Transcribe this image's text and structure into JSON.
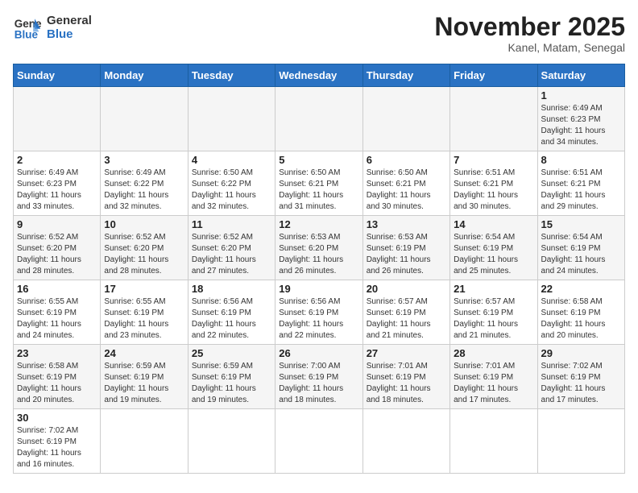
{
  "header": {
    "logo_general": "General",
    "logo_blue": "Blue",
    "month_title": "November 2025",
    "location": "Kanel, Matam, Senegal"
  },
  "weekdays": [
    "Sunday",
    "Monday",
    "Tuesday",
    "Wednesday",
    "Thursday",
    "Friday",
    "Saturday"
  ],
  "weeks": [
    [
      {
        "day": "",
        "info": ""
      },
      {
        "day": "",
        "info": ""
      },
      {
        "day": "",
        "info": ""
      },
      {
        "day": "",
        "info": ""
      },
      {
        "day": "",
        "info": ""
      },
      {
        "day": "",
        "info": ""
      },
      {
        "day": "1",
        "info": "Sunrise: 6:49 AM\nSunset: 6:23 PM\nDaylight: 11 hours\nand 34 minutes."
      }
    ],
    [
      {
        "day": "2",
        "info": "Sunrise: 6:49 AM\nSunset: 6:23 PM\nDaylight: 11 hours\nand 33 minutes."
      },
      {
        "day": "3",
        "info": "Sunrise: 6:49 AM\nSunset: 6:22 PM\nDaylight: 11 hours\nand 32 minutes."
      },
      {
        "day": "4",
        "info": "Sunrise: 6:50 AM\nSunset: 6:22 PM\nDaylight: 11 hours\nand 32 minutes."
      },
      {
        "day": "5",
        "info": "Sunrise: 6:50 AM\nSunset: 6:21 PM\nDaylight: 11 hours\nand 31 minutes."
      },
      {
        "day": "6",
        "info": "Sunrise: 6:50 AM\nSunset: 6:21 PM\nDaylight: 11 hours\nand 30 minutes."
      },
      {
        "day": "7",
        "info": "Sunrise: 6:51 AM\nSunset: 6:21 PM\nDaylight: 11 hours\nand 30 minutes."
      },
      {
        "day": "8",
        "info": "Sunrise: 6:51 AM\nSunset: 6:21 PM\nDaylight: 11 hours\nand 29 minutes."
      }
    ],
    [
      {
        "day": "9",
        "info": "Sunrise: 6:52 AM\nSunset: 6:20 PM\nDaylight: 11 hours\nand 28 minutes."
      },
      {
        "day": "10",
        "info": "Sunrise: 6:52 AM\nSunset: 6:20 PM\nDaylight: 11 hours\nand 28 minutes."
      },
      {
        "day": "11",
        "info": "Sunrise: 6:52 AM\nSunset: 6:20 PM\nDaylight: 11 hours\nand 27 minutes."
      },
      {
        "day": "12",
        "info": "Sunrise: 6:53 AM\nSunset: 6:20 PM\nDaylight: 11 hours\nand 26 minutes."
      },
      {
        "day": "13",
        "info": "Sunrise: 6:53 AM\nSunset: 6:19 PM\nDaylight: 11 hours\nand 26 minutes."
      },
      {
        "day": "14",
        "info": "Sunrise: 6:54 AM\nSunset: 6:19 PM\nDaylight: 11 hours\nand 25 minutes."
      },
      {
        "day": "15",
        "info": "Sunrise: 6:54 AM\nSunset: 6:19 PM\nDaylight: 11 hours\nand 24 minutes."
      }
    ],
    [
      {
        "day": "16",
        "info": "Sunrise: 6:55 AM\nSunset: 6:19 PM\nDaylight: 11 hours\nand 24 minutes."
      },
      {
        "day": "17",
        "info": "Sunrise: 6:55 AM\nSunset: 6:19 PM\nDaylight: 11 hours\nand 23 minutes."
      },
      {
        "day": "18",
        "info": "Sunrise: 6:56 AM\nSunset: 6:19 PM\nDaylight: 11 hours\nand 22 minutes."
      },
      {
        "day": "19",
        "info": "Sunrise: 6:56 AM\nSunset: 6:19 PM\nDaylight: 11 hours\nand 22 minutes."
      },
      {
        "day": "20",
        "info": "Sunrise: 6:57 AM\nSunset: 6:19 PM\nDaylight: 11 hours\nand 21 minutes."
      },
      {
        "day": "21",
        "info": "Sunrise: 6:57 AM\nSunset: 6:19 PM\nDaylight: 11 hours\nand 21 minutes."
      },
      {
        "day": "22",
        "info": "Sunrise: 6:58 AM\nSunset: 6:19 PM\nDaylight: 11 hours\nand 20 minutes."
      }
    ],
    [
      {
        "day": "23",
        "info": "Sunrise: 6:58 AM\nSunset: 6:19 PM\nDaylight: 11 hours\nand 20 minutes."
      },
      {
        "day": "24",
        "info": "Sunrise: 6:59 AM\nSunset: 6:19 PM\nDaylight: 11 hours\nand 19 minutes."
      },
      {
        "day": "25",
        "info": "Sunrise: 6:59 AM\nSunset: 6:19 PM\nDaylight: 11 hours\nand 19 minutes."
      },
      {
        "day": "26",
        "info": "Sunrise: 7:00 AM\nSunset: 6:19 PM\nDaylight: 11 hours\nand 18 minutes."
      },
      {
        "day": "27",
        "info": "Sunrise: 7:01 AM\nSunset: 6:19 PM\nDaylight: 11 hours\nand 18 minutes."
      },
      {
        "day": "28",
        "info": "Sunrise: 7:01 AM\nSunset: 6:19 PM\nDaylight: 11 hours\nand 17 minutes."
      },
      {
        "day": "29",
        "info": "Sunrise: 7:02 AM\nSunset: 6:19 PM\nDaylight: 11 hours\nand 17 minutes."
      }
    ],
    [
      {
        "day": "30",
        "info": "Sunrise: 7:02 AM\nSunset: 6:19 PM\nDaylight: 11 hours\nand 16 minutes."
      },
      {
        "day": "",
        "info": ""
      },
      {
        "day": "",
        "info": ""
      },
      {
        "day": "",
        "info": ""
      },
      {
        "day": "",
        "info": ""
      },
      {
        "day": "",
        "info": ""
      },
      {
        "day": "",
        "info": ""
      }
    ]
  ]
}
